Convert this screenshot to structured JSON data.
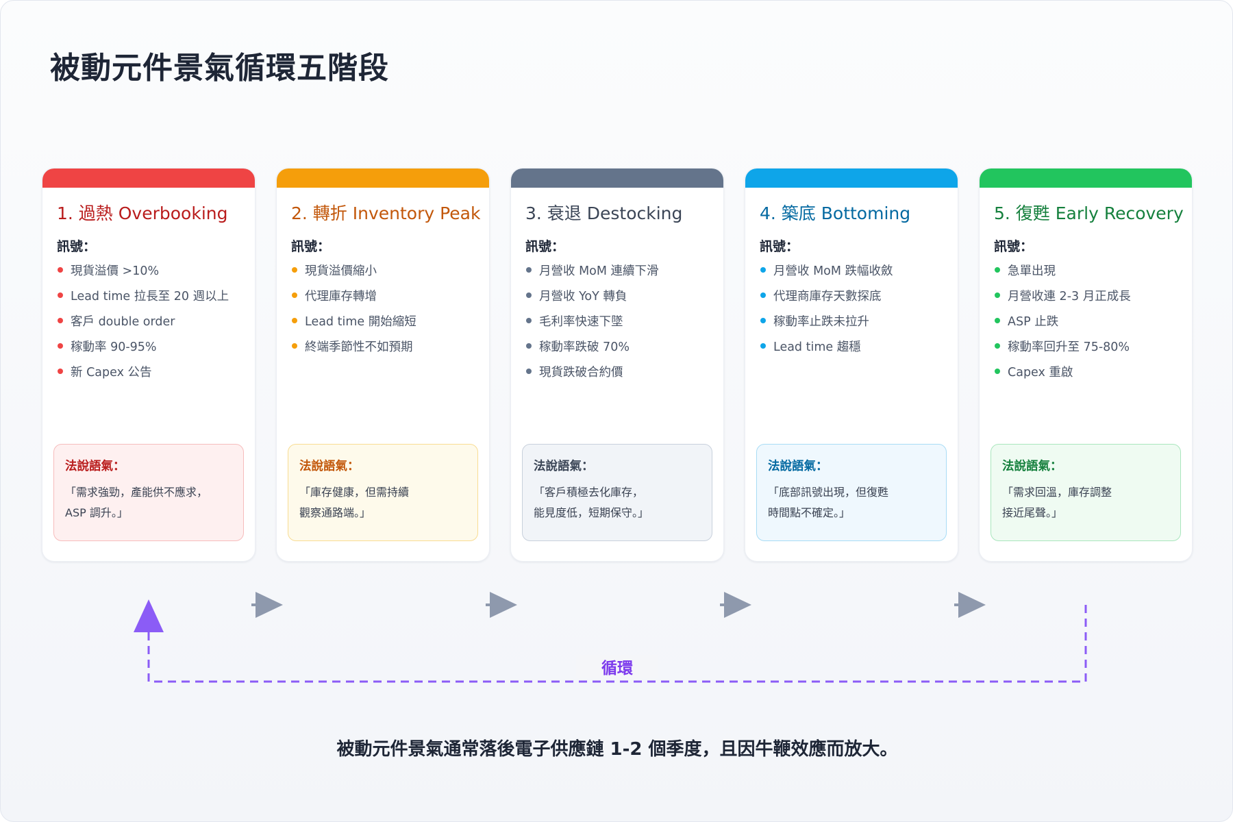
{
  "title": "被動元件景氣循環五階段",
  "signals_label": "訊號：",
  "quote_label": "法說語氣：",
  "cycle_label": "循環",
  "caption": "被動元件景氣通常落後電子供應鏈 1-2 個季度，且因牛鞭效應而放大。",
  "colors": {
    "red": "#ef4444",
    "orange": "#f59e0b",
    "slate": "#64748b",
    "sky": "#0ea5e9",
    "green": "#22c55e",
    "purple": "#8b5cf6",
    "arrow_gray": "#8e99ad"
  },
  "stages": [
    {
      "title": "1. 過熱 Overbooking",
      "signals": [
        "現貨溢價 >10%",
        "Lead time 拉長至 20 週以上",
        "客戶 double order",
        "稼動率 90-95%",
        "新 Capex 公告"
      ],
      "quote_lines": [
        "「需求強勁，產能供不應求，",
        "ASP 調升。」"
      ]
    },
    {
      "title": "2. 轉折 Inventory Peak",
      "signals": [
        "現貨溢價縮小",
        "代理庫存轉增",
        "Lead time 開始縮短",
        "終端季節性不如預期"
      ],
      "quote_lines": [
        "「庫存健康，但需持續",
        "觀察通路端。」"
      ]
    },
    {
      "title": "3. 衰退 Destocking",
      "signals": [
        "月營收 MoM 連續下滑",
        "月營收 YoY 轉負",
        "毛利率快速下墜",
        "稼動率跌破 70%",
        "現貨跌破合約價"
      ],
      "quote_lines": [
        "「客戶積極去化庫存，",
        "能見度低，短期保守。」"
      ]
    },
    {
      "title": "4. 築底 Bottoming",
      "signals": [
        "月營收 MoM 跌幅收斂",
        "代理商庫存天數探底",
        "稼動率止跌未拉升",
        "Lead time 趨穩"
      ],
      "quote_lines": [
        "「底部訊號出現，但復甦",
        "時間點不確定。」"
      ]
    },
    {
      "title": "5. 復甦 Early Recovery",
      "signals": [
        "急單出現",
        "月營收連 2-3 月正成長",
        "ASP 止跌",
        "稼動率回升至 75-80%",
        "Capex 重啟"
      ],
      "quote_lines": [
        "「需求回溫，庫存調整",
        "接近尾聲。」"
      ]
    }
  ]
}
